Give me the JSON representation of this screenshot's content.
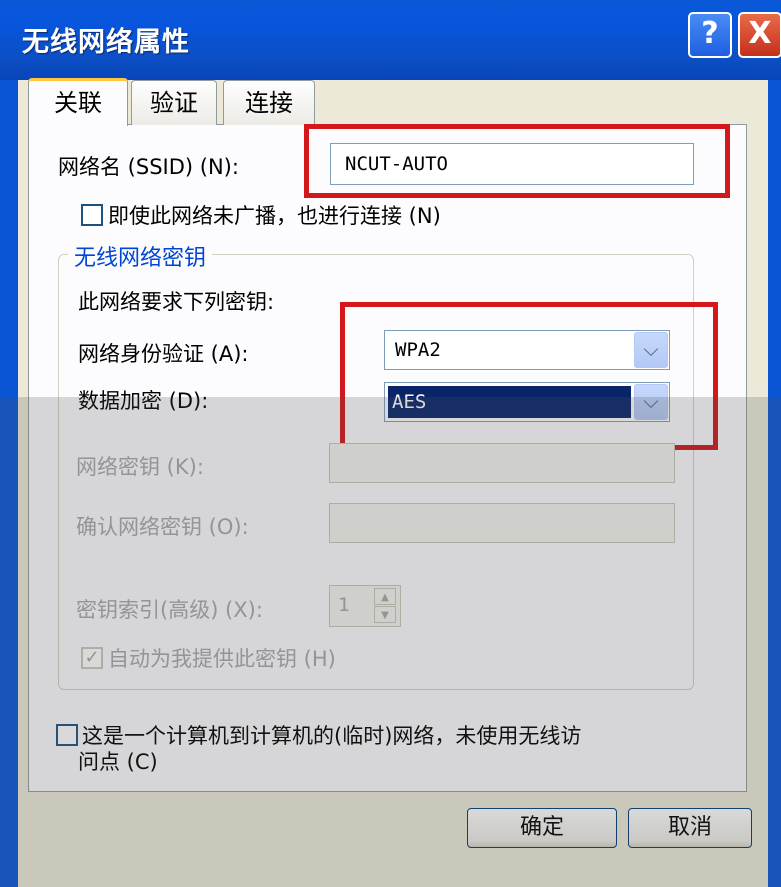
{
  "window": {
    "title": "无线网络属性",
    "help_label": "?",
    "close_label": "X"
  },
  "tabs": [
    {
      "label": "关联",
      "active": true
    },
    {
      "label": "验证",
      "active": false
    },
    {
      "label": "连接",
      "active": false
    }
  ],
  "association": {
    "ssid_label": "网络名 (SSID) (N):",
    "ssid_value": "NCUT-AUTO",
    "connect_hidden_label": "即使此网络未广播，也进行连接 (N)",
    "connect_hidden_checked": false
  },
  "wireless_key": {
    "group_title": "无线网络密钥",
    "intro": "此网络要求下列密钥:",
    "auth_label": "网络身份验证 (A):",
    "auth_value": "WPA2",
    "encryption_label": "数据加密 (D):",
    "encryption_value": "AES",
    "network_key_label": "网络密钥 (K):",
    "confirm_key_label": "确认网络密钥 (O):",
    "key_index_label": "密钥索引(高级) (X):",
    "key_index_value": "1",
    "auto_key_label": "自动为我提供此密钥 (H)",
    "auto_key_checked": true
  },
  "adhoc": {
    "label_line1": "这是一个计算机到计算机的(临时)网络，未使用无线访",
    "label_line2": "问点 (C)",
    "checked": false
  },
  "buttons": {
    "ok": "确定",
    "cancel": "取消"
  },
  "icons": {
    "dropdown_arrow": "chevron-down-icon",
    "check_mark": "✓",
    "spin_up": "▲",
    "spin_down": "▼"
  },
  "colors": {
    "titlebar": "#0a55d6",
    "group_title": "#0046d5",
    "highlight_box": "#d3171b",
    "selected_combo": "#0a246a"
  }
}
